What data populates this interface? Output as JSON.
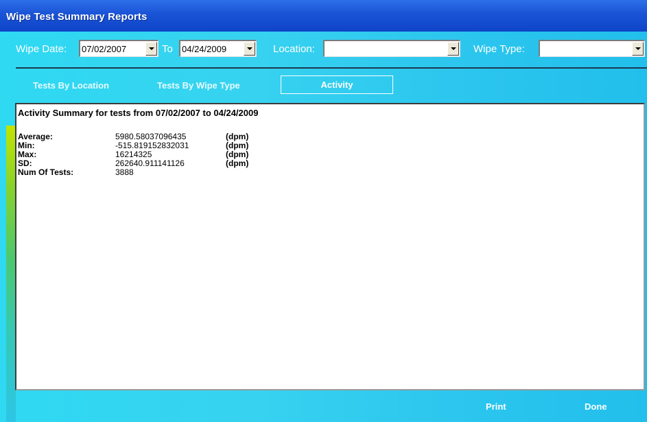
{
  "window": {
    "title": "Wipe Test Summary Reports"
  },
  "filters": {
    "wipe_date_label": "Wipe Date:",
    "wipe_date_from": "07/02/2007",
    "to_label": "To",
    "wipe_date_to": "04/24/2009",
    "location_label": "Location:",
    "location_value": "",
    "wipe_type_label": "Wipe Type:",
    "wipe_type_value": ""
  },
  "tabs": [
    {
      "label": "Tests By Location",
      "active": false
    },
    {
      "label": "Tests By Wipe Type",
      "active": false
    },
    {
      "label": "Activity",
      "active": true
    }
  ],
  "report": {
    "heading": "Activity Summary for tests from 07/02/2007 to 04/24/2009",
    "rows": [
      {
        "label": "Average:",
        "value": "5980.58037096435",
        "unit": "(dpm)"
      },
      {
        "label": "Min:",
        "value": "-515.819152832031",
        "unit": "(dpm)"
      },
      {
        "label": "Max:",
        "value": "16214325",
        "unit": "(dpm)"
      },
      {
        "label": "SD:",
        "value": "262640.911141126",
        "unit": "(dpm)"
      },
      {
        "label": "Num Of Tests:",
        "value": "3888",
        "unit": ""
      }
    ]
  },
  "buttons": {
    "print": "Print",
    "done": "Done"
  }
}
